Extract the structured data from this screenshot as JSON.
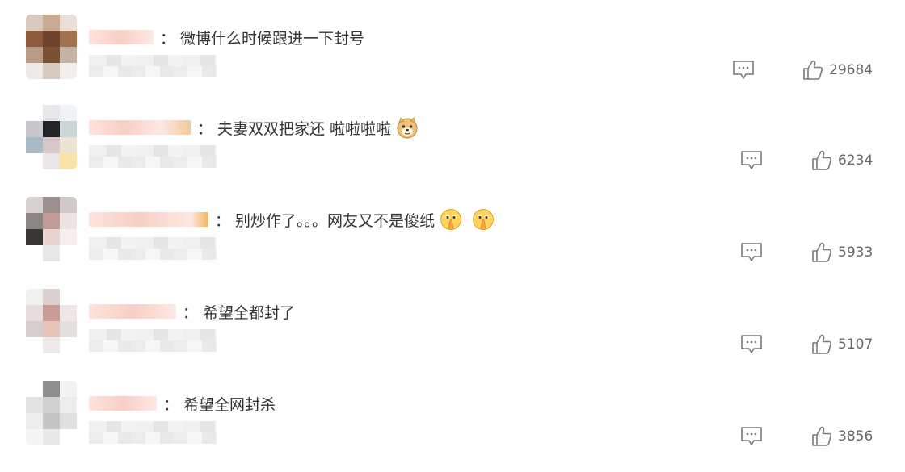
{
  "colors": {
    "text": "#333333",
    "count": "#666666",
    "icon": "#7a7a7a",
    "username_blur": "#fbd6cc"
  },
  "comments": [
    {
      "text": "微博什么时候跟进一下封号",
      "colon": "：",
      "emojis": [],
      "like_count": "29684",
      "reply_icon": "comment-icon",
      "like_icon": "thumbs-up-icon"
    },
    {
      "text": "夫妻双双把家还 啦啦啦啦",
      "colon": "：",
      "emojis": [
        "doge-emoji"
      ],
      "like_count": "6234",
      "reply_icon": "comment-icon",
      "like_icon": "thumbs-up-icon"
    },
    {
      "text": "别炒作了。。。网友又不是傻纸",
      "colon": "：",
      "emojis": [
        "pray-emoji",
        "pray-emoji"
      ],
      "like_count": "5933",
      "reply_icon": "comment-icon",
      "like_icon": "thumbs-up-icon"
    },
    {
      "text": "希望全都封了",
      "colon": "：",
      "emojis": [],
      "like_count": "5107",
      "reply_icon": "comment-icon",
      "like_icon": "thumbs-up-icon"
    },
    {
      "text": "希望全网封杀",
      "colon": "：",
      "emojis": [],
      "like_count": "3856",
      "reply_icon": "comment-icon",
      "like_icon": "thumbs-up-icon"
    }
  ]
}
